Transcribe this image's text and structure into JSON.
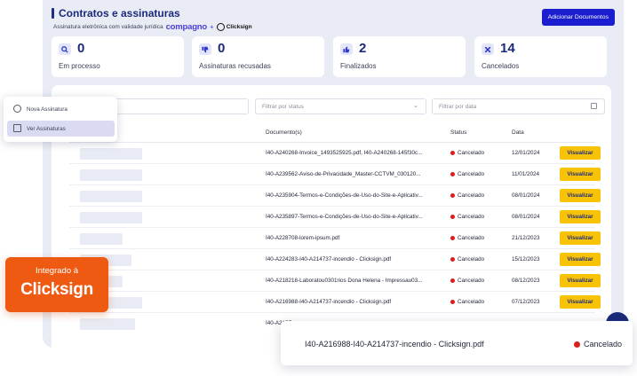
{
  "header": {
    "title": "Contratos e assinaturas",
    "subtitle": "Assinatura eletrônica com validade jurídica",
    "brand_compagno": "compagno",
    "plus": "+",
    "brand_clicksign": "Clicksign",
    "add_button": "Adicionar Documentos"
  },
  "stats": [
    {
      "value": "0",
      "label": "Em processo",
      "icon": "search-icon"
    },
    {
      "value": "0",
      "label": "Assinaturas recusadas",
      "icon": "thumbs-down-icon"
    },
    {
      "value": "2",
      "label": "Finalizados",
      "icon": "thumbs-up-icon"
    },
    {
      "value": "14",
      "label": "Cancelados",
      "icon": "close-icon"
    }
  ],
  "filters": {
    "status_placeholder": "Filtrar por status",
    "date_placeholder": "Filtrar por data"
  },
  "table": {
    "headers": {
      "documents": "Documento(s)",
      "status": "Status",
      "date": "Data"
    },
    "rows": [
      {
        "doc": "I40-A240268-Invoice_1493525925.pdf, I40-A240268-145f30c...",
        "status": "Cancelado",
        "date": "12/01/2024",
        "action": "Visualizar"
      },
      {
        "doc": "I40-A239562-Aviso-de-Privacidade_Master-CCTVM_030120...",
        "status": "Cancelado",
        "date": "11/01/2024",
        "action": "Visualizar"
      },
      {
        "doc": "I40-A235904-Termos-e-Condições-de-Uso-do-Site-e-Aplicativ...",
        "status": "Cancelado",
        "date": "08/01/2024",
        "action": "Visualizar"
      },
      {
        "doc": "I40-A235897-Termos-e-Condições-de-Uso-do-Site-e-Aplicativ...",
        "status": "Cancelado",
        "date": "08/01/2024",
        "action": "Visualizar"
      },
      {
        "doc": "I40-A228708-lorem-ipsum.pdf",
        "status": "Cancelado",
        "date": "21/12/2023",
        "action": "Visualizar"
      },
      {
        "doc": "I40-A224283-I40-A214737-incendio - Clicksign.pdf",
        "status": "Cancelado",
        "date": "15/12/2023",
        "action": "Visualizar"
      },
      {
        "doc": "I40-A218218-Laboratou0301rios Dona Helena - Impressau03...",
        "status": "Cancelado",
        "date": "08/12/2023",
        "action": "Visualizar"
      },
      {
        "doc": "I40-A216988-I40-A214737-incendio - Clicksign.pdf",
        "status": "Cancelado",
        "date": "07/12/2023",
        "action": "Visualizar"
      },
      {
        "doc": "I40-A215F",
        "status": "",
        "date": "",
        "action": ""
      }
    ]
  },
  "side_menu": {
    "items": [
      {
        "label": "Nova Assinatura",
        "icon": "plus-circle-icon"
      },
      {
        "label": "Ver Assinaturas",
        "icon": "document-list-icon"
      }
    ]
  },
  "badge": {
    "line1": "Integrado à",
    "line2": "Clicksign"
  },
  "toast": {
    "doc": "I40-A216988-I40-A214737-incendio - Clicksign.pdf",
    "status": "Cancelado"
  },
  "colors": {
    "primary": "#1a1ecf",
    "title_blue": "#1b2a7a",
    "action_yellow": "#f8c307",
    "cancel_red": "#dc1e1e",
    "badge_orange": "#ef5a12"
  }
}
